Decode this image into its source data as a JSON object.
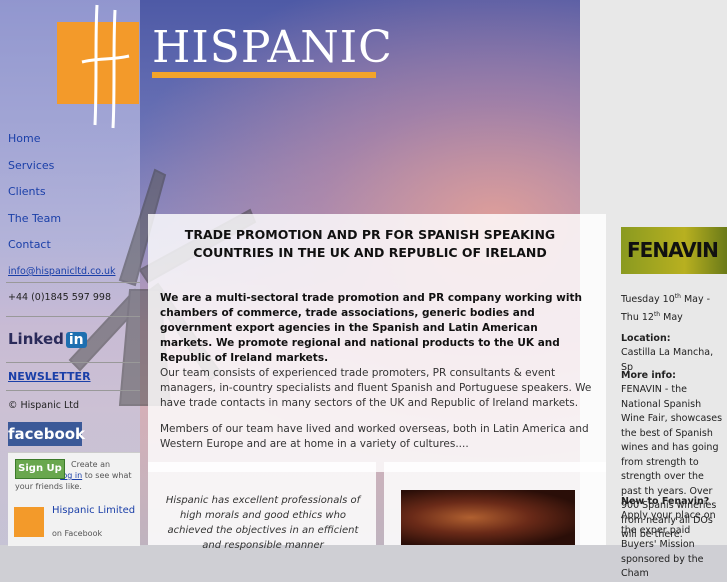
{
  "brand": {
    "name": "HISPANIC",
    "colors": {
      "orange": "#f39a2a",
      "link": "#1a3fa8",
      "facebook": "#3b5998"
    }
  },
  "nav": {
    "items": [
      "Home",
      "Services",
      "Clients",
      "The Team",
      "Contact"
    ]
  },
  "contact": {
    "email": "info@hispanicltd.co.uk",
    "phone": "+44 (0)1845 597 998"
  },
  "social": {
    "linkedin_text": "Linked",
    "linkedin_in": "in",
    "newsletter": "NEWSLETTER",
    "copyright": "© Hispanic Ltd",
    "facebook_badge": "facebook",
    "fb_signup": "Sign Up",
    "fb_text_before": "Create an account or ",
    "fb_login": "log in",
    "fb_text_after": " to see what your friends like.",
    "fb_page_name": "Hispanic Limited",
    "fb_page_on": "on Facebook"
  },
  "main": {
    "heading": "TRADE PROMOTION AND PR FOR SPANISH SPEAKING COUNTRIES IN THE UK AND REPUBLIC OF IRELAND",
    "intro": "We are a multi-sectoral trade promotion and PR company working with chambers of commerce, trade associations, generic bodies and government export agencies in the Spanish and Latin American markets. We promote regional and national products to the UK and Republic of Ireland markets.",
    "para1": "Our team consists of experienced trade promoters, PR consultants & event managers, in-country specialists and fluent Spanish and Portuguese speakers. We have trade contacts in many sectors of the UK and Republic of Ireland markets.",
    "para2": "Members of our team have lived and worked overseas, both in Latin America and Western Europe and are at home in a variety of cultures....",
    "quote": "Hispanic has excellent professionals of high morals and good ethics who achieved the objectives in an efficient and responsible manner"
  },
  "sidebar": {
    "event_image_text": "FENAVIN",
    "date_a": "Tuesday 10",
    "date_sup_a": "th",
    "date_b": " May - Thu 12",
    "date_sup_b": "th",
    "date_c": " May",
    "location_label": "Location:",
    "location": "Castilla La Mancha, Sp",
    "more_label": "More info:",
    "more_text": "FENAVIN - the National Spanish Wine Fair, showcases the best of Spanish wines and has going from strength to strength over the past th years. Over 900 Spanis wineries from nearly all DOs will be there.",
    "new_label": "New to Fenavin?",
    "new_text": "Apply your place on the exper paid Buyers' Mission sponsored by the Cham"
  }
}
